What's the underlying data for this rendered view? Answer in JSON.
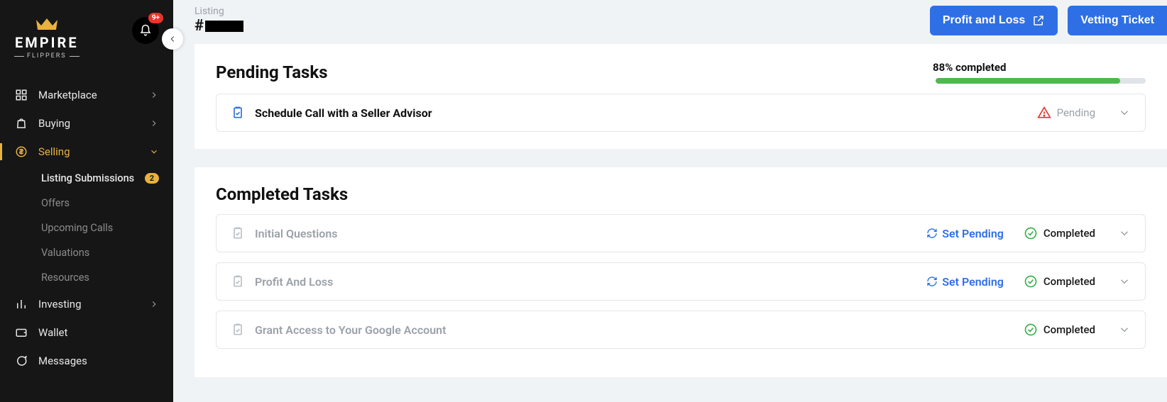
{
  "logo": {
    "name": "EMPIRE",
    "sub": "FLIPPERS"
  },
  "notifications": {
    "badge": "9+"
  },
  "sidebar": {
    "items": [
      {
        "label": "Marketplace"
      },
      {
        "label": "Buying"
      },
      {
        "label": "Selling"
      },
      {
        "label": "Investing"
      },
      {
        "label": "Wallet"
      },
      {
        "label": "Messages"
      }
    ],
    "selling_sub": [
      {
        "label": "Listing Submissions",
        "count": "2"
      },
      {
        "label": "Offers"
      },
      {
        "label": "Upcoming Calls"
      },
      {
        "label": "Valuations"
      },
      {
        "label": "Resources"
      }
    ]
  },
  "header": {
    "label": "Listing",
    "prefix": "#",
    "buttons": {
      "pnl": "Profit and Loss",
      "vetting": "Vetting Ticket"
    }
  },
  "pending": {
    "title": "Pending Tasks",
    "progress_label": "88% completed",
    "progress_pct": 88,
    "tasks": [
      {
        "title": "Schedule Call with a Seller Advisor",
        "status": "Pending"
      }
    ]
  },
  "completed": {
    "title": "Completed Tasks",
    "set_pending_label": "Set Pending",
    "completed_label": "Completed",
    "tasks": [
      {
        "title": "Initial Questions",
        "can_reset": true
      },
      {
        "title": "Profit And Loss",
        "can_reset": true
      },
      {
        "title": "Grant Access to Your Google Account",
        "can_reset": false
      }
    ]
  }
}
